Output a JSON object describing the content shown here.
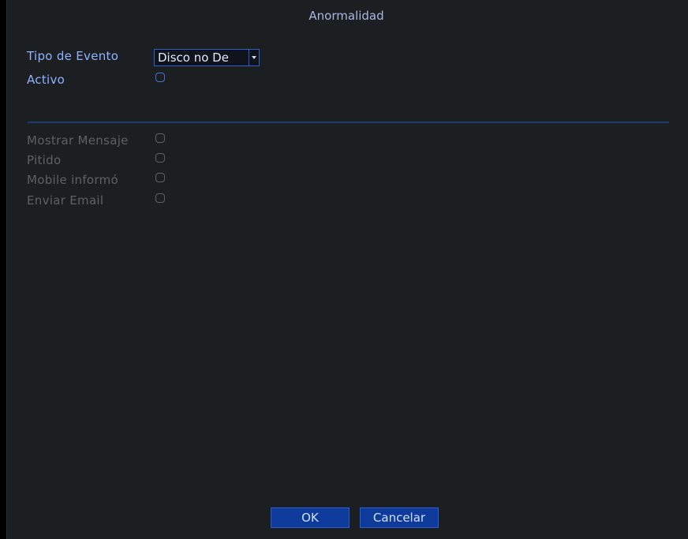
{
  "window": {
    "title": "Anormalidad"
  },
  "form": {
    "event_type_label": "Tipo de Evento",
    "event_type_value": "Disco no De",
    "active_label": "Activo",
    "show_message_label": "Mostrar Mensaje",
    "beep_label": "Pitido",
    "mobile_label": "Mobile informó",
    "email_label": "Enviar Email"
  },
  "buttons": {
    "ok": "OK",
    "cancel": "Cancelar"
  },
  "colors": {
    "background": "#1b1f22",
    "label_active": "#8fb3ff",
    "label_disabled": "#5b6166",
    "button_fill": "#0e3b9b",
    "accent": "#2d5ed0"
  }
}
